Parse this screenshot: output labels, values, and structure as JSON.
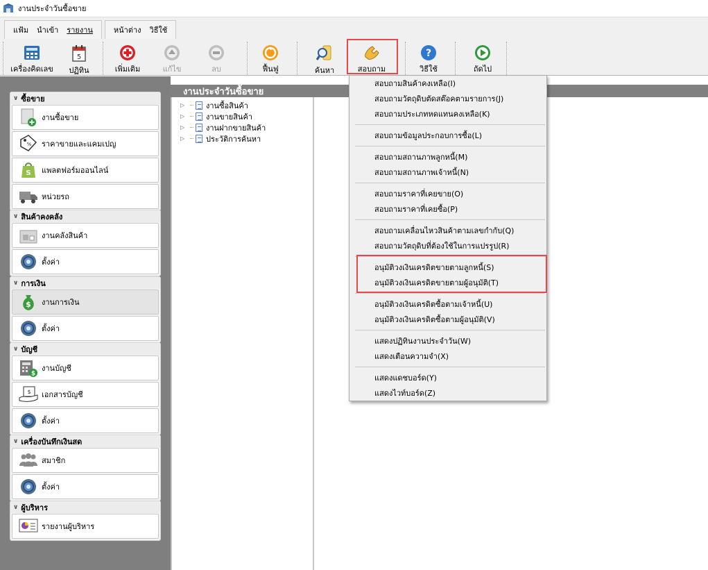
{
  "window": {
    "title": "งานประจำวันซื้อขาย"
  },
  "menubar": {
    "group1": [
      "แฟ้ม",
      "นำเข้า",
      "รายงาน"
    ],
    "group2": [
      "หน้าต่าง",
      "วิธีใช้"
    ]
  },
  "toolbar": {
    "calculator": "เครื่องคิดเลข",
    "calendar": "ปฏิทิน",
    "add": "เพิ่มเติม",
    "edit": "แก้ไข",
    "delete": "ลบ",
    "restore": "ฟื้นฟู",
    "search": "ค้นหา",
    "inquire": "สอบถาม",
    "help": "วิธีใช้",
    "next": "ถัดไป"
  },
  "sidebar": {
    "groups": [
      {
        "title": "ซื้อขาย",
        "items": [
          "งานซื้อขาย",
          "ราคาขายและแคมเปญ",
          "แพลตฟอร์มออนไลน์",
          "หน่วยรถ"
        ]
      },
      {
        "title": "สินค้าคงคลัง",
        "items": [
          "งานคลังสินค้า",
          "ตั้งค่า"
        ]
      },
      {
        "title": "การเงิน",
        "items": [
          "งานการเงิน",
          "ตั้งค่า"
        ]
      },
      {
        "title": "บัญชี",
        "items": [
          "งานบัญชี",
          "เอกสารบัญชี",
          "ตั้งค่า"
        ]
      },
      {
        "title": "เครื่องบันทึกเงินสด",
        "items": [
          "สมาชิก",
          "ตั้งค่า"
        ]
      },
      {
        "title": "ผู้บริหาร",
        "items": [
          "รายงานผู้บริหาร"
        ]
      }
    ]
  },
  "content": {
    "header": "งานประจำวันซื้อขาย",
    "tree": [
      "งานซื้อสินค้า",
      "งานขายสินค้า",
      "งานฝากขายสินค้า",
      "ประวัติการค้นหา"
    ]
  },
  "dropdown": {
    "items": [
      "สอบถามสินค้าคงเหลือ(I)",
      "สอบถามวัตถุดิบตัดสต๊อคตามรายการ(J)",
      "สอบถามประเภทหดแทนคงเหลือ(K)",
      "สอบถามข้อมูลประกอบการซื้อ(L)",
      "สอบถามสถานภาพลูกหนี้(M)",
      "สอบถามสถานภาพเจ้าหนี้(N)",
      "สอบถามราคาที่เคยขาย(O)",
      "สอบถามราคาที่เคยซื้อ(P)",
      "สอบถามเคลื่อนไหวสินค้าตามเลขกำกับ(Q)",
      "สอบถามวัตถุดิบที่ต้องใช้ในการแปรรูป(R)",
      "อนุมัติวงเงินเครดิตขายตามลูกหนี้(S)",
      "อนุมัติวงเงินเครดิตขายตามผู้อนุมัติ(T)",
      "อนุมัติวงเงินเครดิตซื้อตามเจ้าหนี้(U)",
      "อนุมัติวงเงินเครดิตซื้อตามผู้อนุมัติ(V)",
      "แสดงปฏิทินงานประจำวัน(W)",
      "แสดงเตือนความจำ(X)",
      "แสดงแดชบอร์ด(Y)",
      "แสดงไวท์บอร์ด(Z)"
    ]
  },
  "colors": {
    "highlight": "#e5484d",
    "panel_bg": "#7f7f7f",
    "header_bg": "#808080"
  }
}
